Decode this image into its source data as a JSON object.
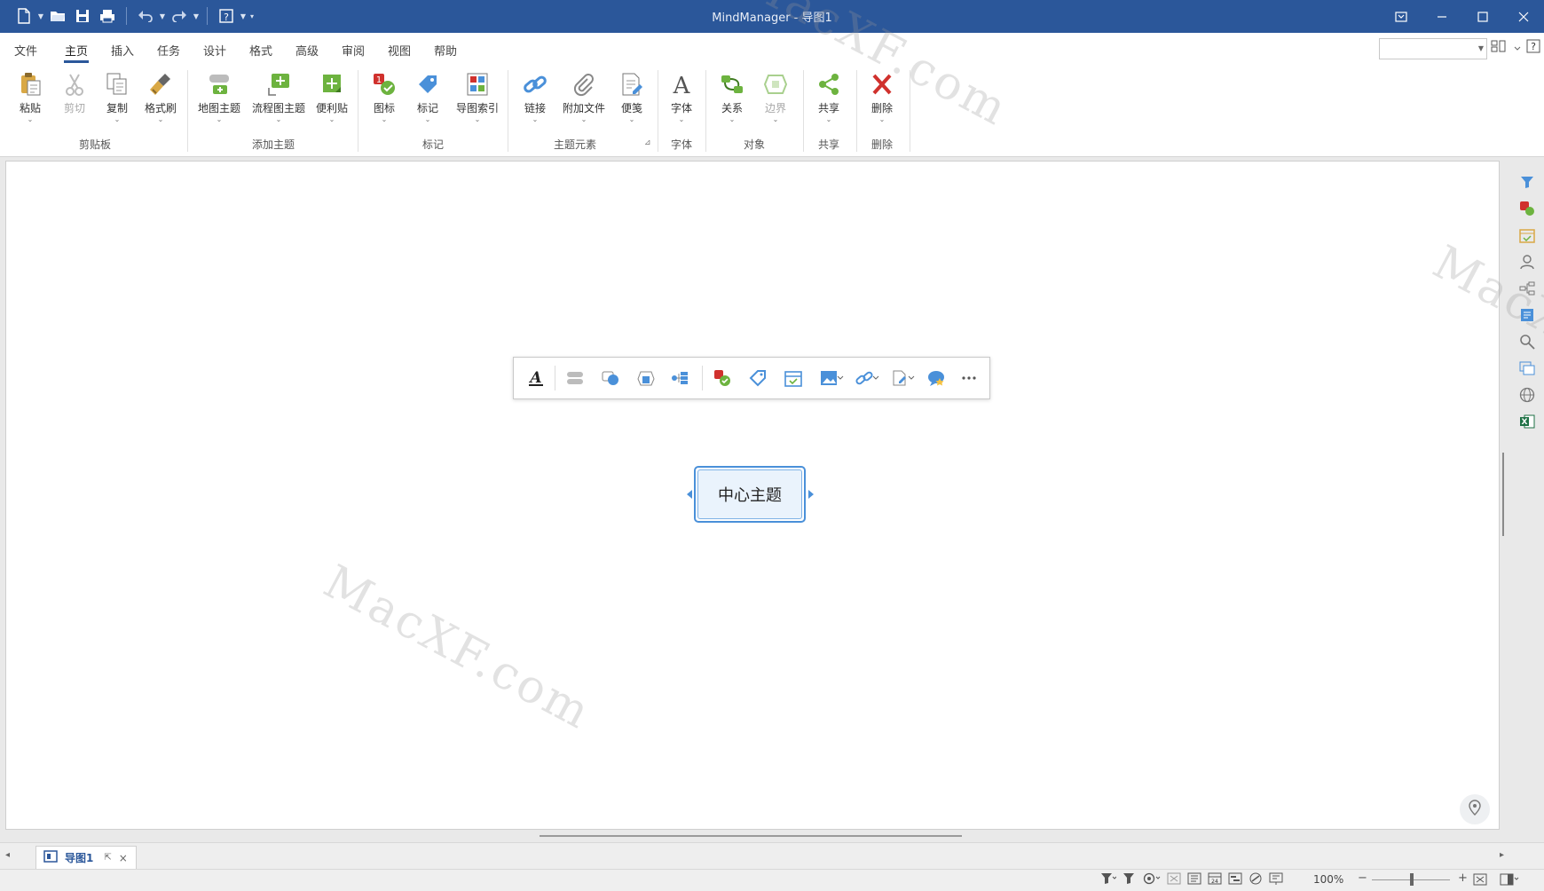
{
  "window": {
    "title": "MindManager - 导图1"
  },
  "quick_access": {
    "icons": [
      "new-document-icon",
      "open-folder-icon",
      "save-icon",
      "print-icon",
      "undo-icon",
      "redo-icon",
      "help-icon"
    ]
  },
  "ribbon_tabs": [
    {
      "label": "文件"
    },
    {
      "label": "主页",
      "active": true
    },
    {
      "label": "插入"
    },
    {
      "label": "任务"
    },
    {
      "label": "设计"
    },
    {
      "label": "格式"
    },
    {
      "label": "高级"
    },
    {
      "label": "审阅"
    },
    {
      "label": "视图"
    },
    {
      "label": "帮助"
    }
  ],
  "ribbon": {
    "groups": [
      {
        "label": "剪贴板",
        "buttons": [
          {
            "label": "粘贴",
            "icon": "paste-icon"
          },
          {
            "label": "剪切",
            "icon": "cut-icon",
            "disabled": true
          },
          {
            "label": "复制",
            "icon": "copy-icon"
          },
          {
            "label": "格式刷",
            "icon": "format-painter-icon"
          }
        ]
      },
      {
        "label": "添加主题",
        "buttons": [
          {
            "label": "地图主题",
            "icon": "map-topic-icon"
          },
          {
            "label": "流程图主题",
            "icon": "flowchart-topic-icon"
          },
          {
            "label": "便利贴",
            "icon": "sticky-note-icon"
          }
        ]
      },
      {
        "label": "标记",
        "buttons": [
          {
            "label": "图标",
            "icon": "icon-marker-icon"
          },
          {
            "label": "标记",
            "icon": "tag-icon"
          },
          {
            "label": "导图索引",
            "icon": "map-index-icon"
          }
        ]
      },
      {
        "label": "主题元素",
        "buttons": [
          {
            "label": "链接",
            "icon": "link-icon"
          },
          {
            "label": "附加文件",
            "icon": "attachment-icon"
          },
          {
            "label": "便笺",
            "icon": "notes-icon"
          }
        ]
      },
      {
        "label": "字体",
        "buttons": [
          {
            "label": "字体",
            "icon": "font-icon"
          }
        ]
      },
      {
        "label": "对象",
        "buttons": [
          {
            "label": "关系",
            "icon": "relationship-icon"
          },
          {
            "label": "边界",
            "icon": "boundary-icon",
            "disabled": true
          }
        ]
      },
      {
        "label": "共享",
        "buttons": [
          {
            "label": "共享",
            "icon": "share-icon"
          }
        ]
      },
      {
        "label": "删除",
        "buttons": [
          {
            "label": "删除",
            "icon": "delete-icon"
          }
        ]
      }
    ]
  },
  "search": {
    "value": "",
    "placeholder": ""
  },
  "floating_toolbar": {
    "icons": [
      "text-format-icon",
      "topic-shape-icon",
      "callout-shape-icon",
      "boundary-shape-icon",
      "layout-icon",
      "icon-marker-icon",
      "tag-icon",
      "calendar-icon",
      "image-icon",
      "link-icon",
      "attachment-icon",
      "comment-icon",
      "more-icon"
    ]
  },
  "map": {
    "central_topic": "中心主题"
  },
  "right_sidebar": {
    "icons": [
      "filter-icon",
      "icon-markers-icon",
      "task-info-icon",
      "resources-icon",
      "map-parts-icon",
      "library-icon",
      "search-icon",
      "outline-icon",
      "browser-icon",
      "excel-icon"
    ]
  },
  "document_tabs": [
    {
      "label": "导图1"
    }
  ],
  "status_bar": {
    "zoom_label": "100%",
    "zoom_level": 100
  },
  "watermark": {
    "text": "MacXF.com"
  },
  "colors": {
    "titlebar": "#2b579a",
    "accent": "#2b579a",
    "topic_border": "#4a90d9",
    "topic_fill": "#eaf3fc"
  }
}
